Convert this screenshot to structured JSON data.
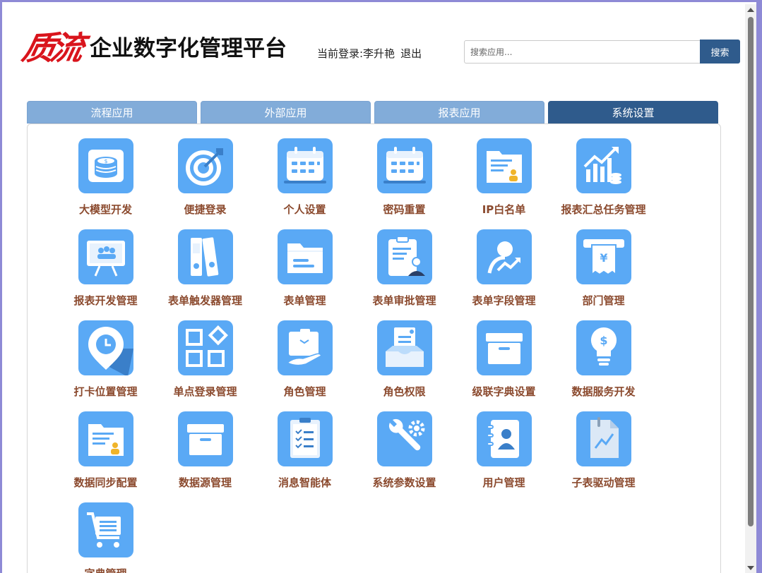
{
  "header": {
    "logo_mark": "质流",
    "logo_text": "企业数字化管理平台",
    "current_user_label": "当前登录:李升艳",
    "logout_label": "退出"
  },
  "search": {
    "placeholder": "搜索应用...",
    "button_label": "搜索"
  },
  "tabs": [
    {
      "label": "流程应用"
    },
    {
      "label": "外部应用"
    },
    {
      "label": "报表应用"
    },
    {
      "label": "系统设置",
      "active": true
    }
  ],
  "apps": [
    {
      "label": "大模型开发",
      "icon": "money-stack-icon"
    },
    {
      "label": "便捷登录",
      "icon": "target-icon"
    },
    {
      "label": "个人设置",
      "icon": "calendar-icon"
    },
    {
      "label": "密码重置",
      "icon": "calendar-icon"
    },
    {
      "label": "IP白名单",
      "icon": "folder-people-icon"
    },
    {
      "label": "报表汇总任务管理",
      "icon": "growth-chart-icon"
    },
    {
      "label": "报表开发管理",
      "icon": "presentation-board-icon"
    },
    {
      "label": "表单触发器管理",
      "icon": "binders-icon"
    },
    {
      "label": "表单管理",
      "icon": "folder-icon"
    },
    {
      "label": "表单审批管理",
      "icon": "clipboard-user-icon"
    },
    {
      "label": "表单字段管理",
      "icon": "user-trend-icon"
    },
    {
      "label": "部门管理",
      "icon": "receipt-yuan-icon"
    },
    {
      "label": "打卡位置管理",
      "icon": "location-clock-icon"
    },
    {
      "label": "单点登录管理",
      "icon": "grid-apps-icon"
    },
    {
      "label": "角色管理",
      "icon": "hand-box-icon"
    },
    {
      "label": "角色权限",
      "icon": "inbox-document-icon"
    },
    {
      "label": "级联字典设置",
      "icon": "archive-box-icon"
    },
    {
      "label": "数据服务开发",
      "icon": "lightbulb-dollar-icon"
    },
    {
      "label": "数据同步配置",
      "icon": "folder-people-icon"
    },
    {
      "label": "数据源管理",
      "icon": "archive-box-icon"
    },
    {
      "label": "消息智能体",
      "icon": "checklist-clipboard-icon"
    },
    {
      "label": "系统参数设置",
      "icon": "wrench-gear-icon"
    },
    {
      "label": "用户管理",
      "icon": "contact-book-icon"
    },
    {
      "label": "子表驱动管理",
      "icon": "chart-document-icon"
    },
    {
      "label": "字典管理",
      "icon": "shopping-cart-icon"
    }
  ],
  "colors": {
    "tab_inactive": "#82acd9",
    "tab_active": "#2f5b8c",
    "icon_bg": "#5aa9f5",
    "label": "#8b4a2e",
    "logo_red": "#d9141c"
  }
}
